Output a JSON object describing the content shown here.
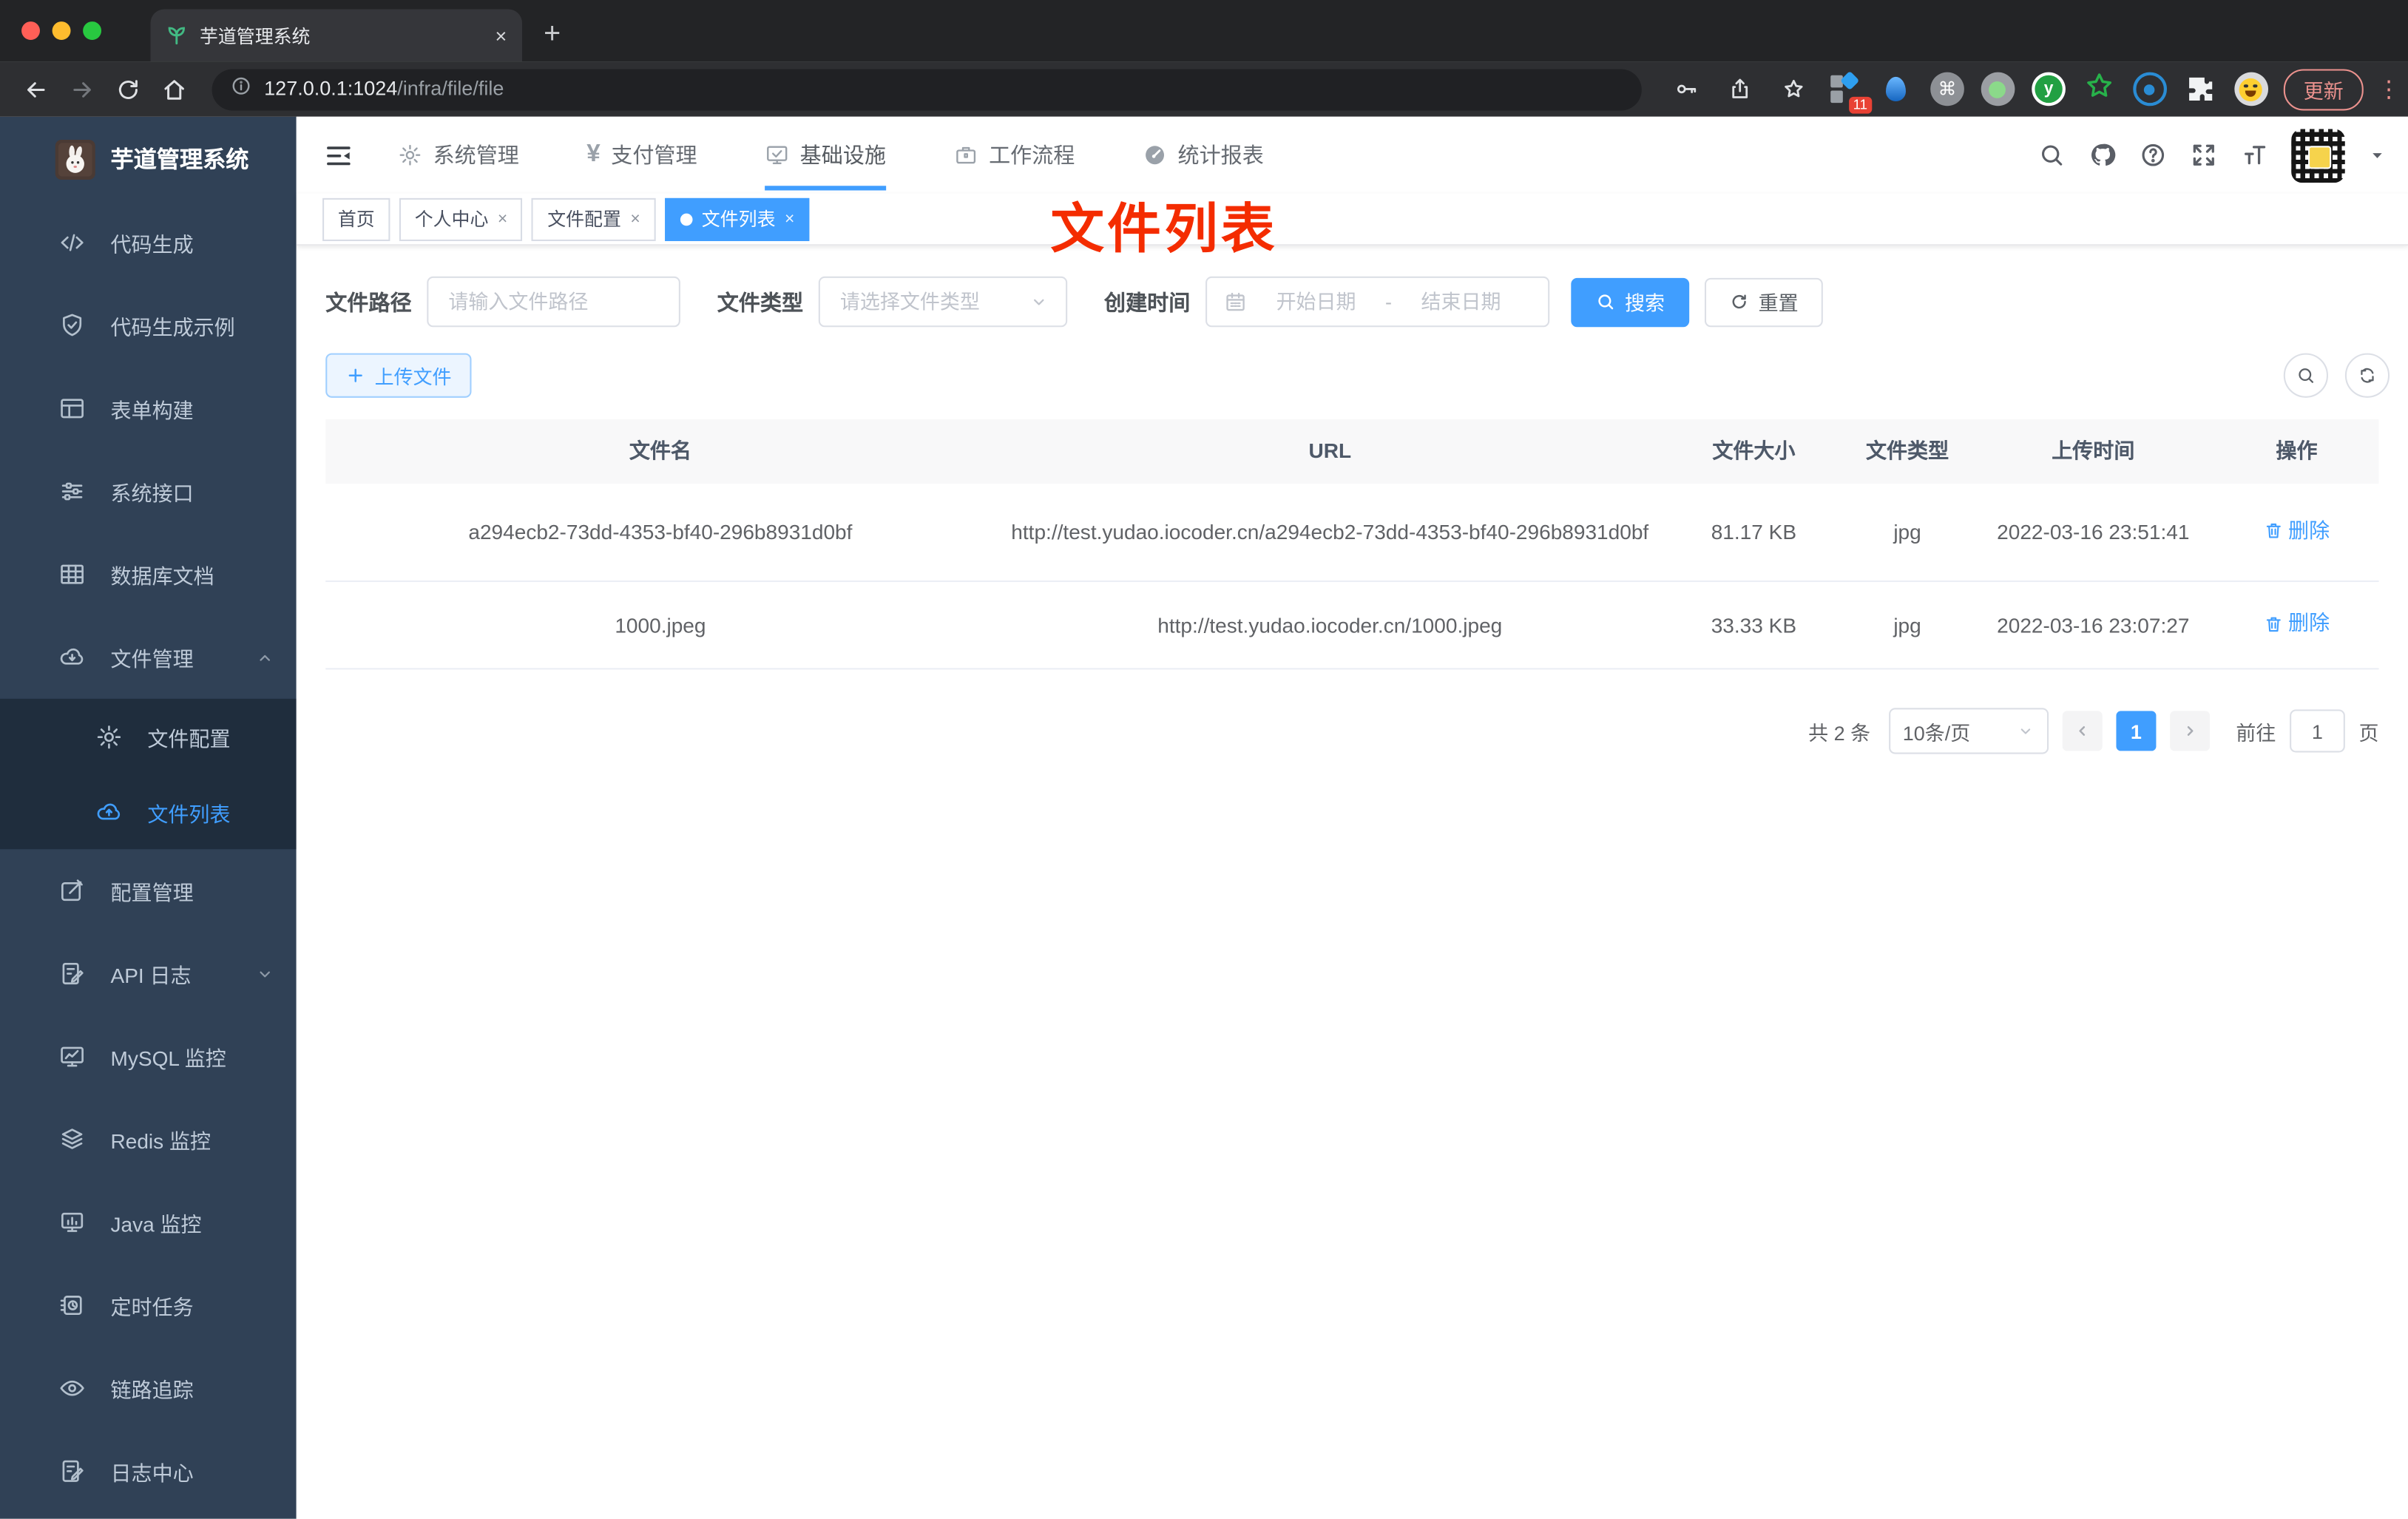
{
  "colors": {
    "accent": "#409eff",
    "sidebar_bg": "#304156",
    "submenu_bg": "#1f2d3d",
    "annotation": "#f42c00",
    "active_tag_bg": "#409eff"
  },
  "browser": {
    "tab": {
      "title": "芋道管理系统",
      "close": "×",
      "new_tab": "+"
    },
    "url_host": "127.0.0.1:1024",
    "url_path": "/infra/file/file",
    "extensions": [
      {
        "icon": "pin-badge-icon",
        "badge": "11"
      },
      {
        "icon": "balloon-icon"
      },
      {
        "icon": "command-icon",
        "glyph": "⌘"
      },
      {
        "icon": "record-dot-icon"
      },
      {
        "icon": "y-circle-icon",
        "glyph": "y"
      },
      {
        "icon": "green-star-icon"
      },
      {
        "icon": "blue-eye-icon"
      },
      {
        "icon": "puzzle-icon"
      },
      {
        "icon": "emoji-icon"
      }
    ],
    "update_label": "更新"
  },
  "app": {
    "logo_title": "芋道管理系统",
    "sidebar": {
      "items": [
        {
          "icon": "code",
          "label": "代码生成"
        },
        {
          "icon": "shield-check",
          "label": "代码生成示例"
        },
        {
          "icon": "form-table",
          "label": "表单构建"
        },
        {
          "icon": "sliders",
          "label": "系统接口"
        },
        {
          "icon": "db-grid",
          "label": "数据库文档"
        },
        {
          "icon": "cloud-down",
          "label": "文件管理",
          "chevron": "up",
          "children": [
            {
              "icon": "gear",
              "label": "文件配置"
            },
            {
              "icon": "cloud-up",
              "label": "文件列表",
              "active": true
            }
          ]
        },
        {
          "icon": "edit-square",
          "label": "配置管理"
        },
        {
          "icon": "doc-edit",
          "label": "API 日志",
          "chevron": "down"
        },
        {
          "icon": "chart-monitor",
          "label": "MySQL 监控"
        },
        {
          "icon": "layers",
          "label": "Redis 监控"
        },
        {
          "icon": "java-monitor",
          "label": "Java 监控"
        },
        {
          "icon": "timer",
          "label": "定时任务"
        },
        {
          "icon": "eye",
          "label": "链路追踪"
        },
        {
          "icon": "doc-edit",
          "label": "日志中心"
        }
      ]
    },
    "topnav": {
      "items": [
        {
          "icon": "gear",
          "label": "系统管理"
        },
        {
          "icon": "yen",
          "label": "支付管理",
          "glyph": "¥"
        },
        {
          "icon": "monitor-check",
          "label": "基础设施",
          "active": true
        },
        {
          "icon": "briefcase",
          "label": "工作流程"
        },
        {
          "icon": "gauge",
          "label": "统计报表"
        }
      ]
    },
    "tags": [
      {
        "label": "首页"
      },
      {
        "label": "个人中心",
        "closable": true
      },
      {
        "label": "文件配置",
        "closable": true
      },
      {
        "label": "文件列表",
        "closable": true,
        "active": true
      }
    ],
    "annotation": {
      "text": "文件列表"
    },
    "filters": {
      "path_label": "文件路径",
      "path_placeholder": "请输入文件路径",
      "type_label": "文件类型",
      "type_placeholder": "请选择文件类型",
      "date_label": "创建时间",
      "date_start_placeholder": "开始日期",
      "date_separator": "-",
      "date_end_placeholder": "结束日期",
      "search_label": "搜索",
      "reset_label": "重置"
    },
    "toolbar": {
      "upload_label": "上传文件"
    },
    "table": {
      "columns": [
        "文件名",
        "URL",
        "文件大小",
        "文件类型",
        "上传时间",
        "操作"
      ],
      "rows": [
        {
          "name": "a294ecb2-73dd-4353-bf40-296b8931d0bf",
          "url": "http://test.yudao.iocoder.cn/a294ecb2-73dd-4353-bf40-296b8931d0bf",
          "size": "81.17 KB",
          "type": "jpg",
          "time": "2022-03-16 23:51:41",
          "action": "删除"
        },
        {
          "name": "1000.jpeg",
          "url": "http://test.yudao.iocoder.cn/1000.jpeg",
          "size": "33.33 KB",
          "type": "jpg",
          "time": "2022-03-16 23:07:27",
          "action": "删除"
        }
      ]
    },
    "pagination": {
      "total": "共 2 条",
      "page_size": "10条/页",
      "current_page": "1",
      "goto_label": "前往",
      "goto_value": "1",
      "page_label": "页"
    }
  }
}
